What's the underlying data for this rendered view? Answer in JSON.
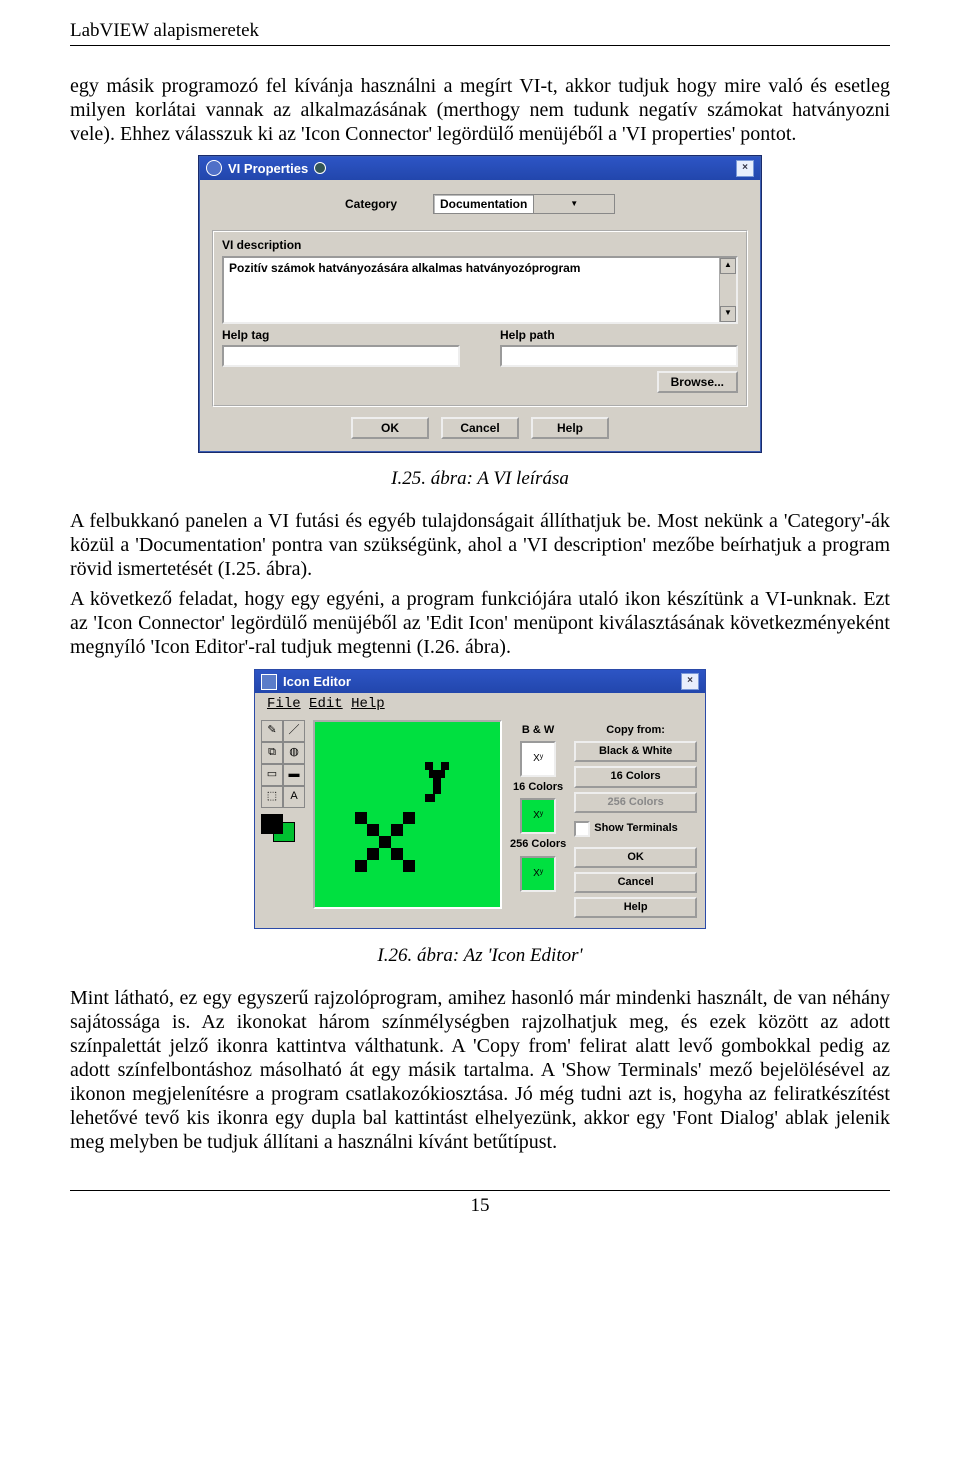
{
  "header": "LabVIEW alapismeretek",
  "para1": "egy másik programozó fel kívánja használni a megírt VI-t, akkor tudjuk hogy mire való és esetleg milyen korlátai vannak az alkalmazásának (merthogy nem tudunk negatív számokat hatványozni vele). Ehhez válasszuk ki az 'Icon Connector' legördülő menüjéből a 'VI properties' pontot.",
  "vi": {
    "title": "VI Properties",
    "category_label": "Category",
    "category_value": "Documentation",
    "desc_label": "VI description",
    "desc_text": "Pozitív számok hatványozására alkalmas hatványozóprogram",
    "help_tag": "Help tag",
    "help_path": "Help path",
    "browse": "Browse...",
    "ok": "OK",
    "cancel": "Cancel",
    "help": "Help"
  },
  "cap1": "I.25. ábra: A VI leírása",
  "para2": "A felbukkanó panelen a VI futási és egyéb tulajdonságait állíthatjuk be. Most nekünk a 'Category'-ák közül a 'Documentation' pontra van szükségünk, ahol a 'VI description' mezőbe beírhatjuk a program rövid ismertetését (I.25. ábra).",
  "para3": "A következő feladat, hogy egy egyéni, a program funkciójára utaló ikon készítünk a VI-unknak. Ezt az 'Icon Connector' legördülő menüjéből az 'Edit Icon' menüpont kiválasztásának következményeként megnyíló 'Icon Editor'-ral tudjuk megtenni (I.26. ábra).",
  "ie": {
    "title": "Icon Editor",
    "menu": {
      "file": "File",
      "edit": "Edit",
      "help": "Help"
    },
    "bw": "B & W",
    "c16": "16 Colors",
    "c256": "256 Colors",
    "preview": "Xʸ",
    "copy_from": "Copy from:",
    "btn_bw": "Black & White",
    "btn_16": "16 Colors",
    "btn_256": "256 Colors",
    "show_term": "Show Terminals",
    "ok": "OK",
    "cancel": "Cancel",
    "help": "Help"
  },
  "cap2": "I.26. ábra: Az 'Icon Editor'",
  "para4": "Mint látható, ez egy egyszerű rajzolóprogram, amihez hasonló már mindenki használt, de van néhány sajátossága is. Az ikonokat három színmélységben rajzolhatjuk meg, és ezek között az adott színpalettát jelző ikonra kattintva válthatunk. A 'Copy from' felirat alatt levő gombokkal pedig az adott színfelbontáshoz másolható át egy másik tartalma. A 'Show Terminals' mező bejelölésével az ikonon megjelenítésre a program csatlakozókiosztása. Jó még tudni azt is, hogyha az feliratkészítést lehetővé tevő kis ikonra egy dupla bal kattintást elhelyezünk, akkor egy 'Font Dialog' ablak jelenik meg melyben be tudjuk állítani a használni kívánt betűtípust.",
  "pagenum": "15"
}
